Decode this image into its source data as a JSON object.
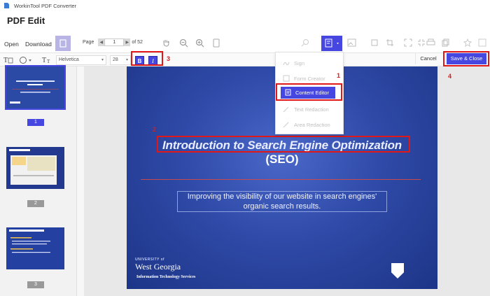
{
  "app": {
    "title": "WorkinTool PDF Converter",
    "section_title": "PDF Edit"
  },
  "toolbar": {
    "open_label": "Open",
    "download_label": "Download",
    "page_label": "Page",
    "page_current": "1",
    "page_total": "of 52"
  },
  "format_bar": {
    "font_family": "Helvetica",
    "font_size": "28",
    "bold_label": "B",
    "italic_label": "I",
    "cancel_label": "Cancel",
    "save_close_label": "Save & Close"
  },
  "edit_menu": {
    "items": [
      {
        "label": "Sign",
        "icon": "sign-icon",
        "enabled": false
      },
      {
        "label": "Form Creator",
        "icon": "form-icon",
        "enabled": false
      },
      {
        "label": "Content Editor",
        "icon": "content-editor-icon",
        "enabled": true,
        "active": true
      },
      {
        "label": "Text Redaction",
        "icon": "text-redaction-icon",
        "enabled": false
      },
      {
        "label": "Area Redaction",
        "icon": "area-redaction-icon",
        "enabled": false
      }
    ]
  },
  "annotations": {
    "step1": "1",
    "step2": "2",
    "step3": "3",
    "step4": "4"
  },
  "thumbnails": [
    {
      "page": "1",
      "selected": true
    },
    {
      "page": "2",
      "selected": false
    },
    {
      "page": "3",
      "selected": false
    }
  ],
  "slide": {
    "title": "Introduction to Search Engine Optimization",
    "subtitle_seo": "(SEO)",
    "body": "Improving the visibility of our website in search engines' organic search results.",
    "university_small": "UNIVERSITY of",
    "university_big": "West Georgia",
    "department": "Information Technology Services"
  },
  "colors": {
    "accent": "#4646e0",
    "highlight": "#e01818",
    "slide_bg": "#2f4aa8"
  }
}
